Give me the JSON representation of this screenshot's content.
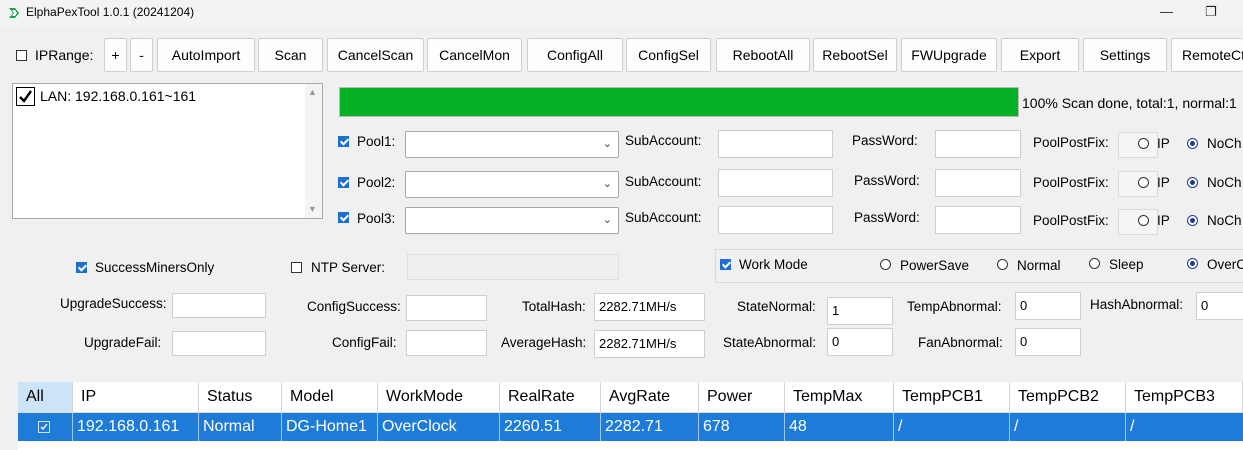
{
  "window": {
    "title": "ElphaPexTool 1.0.1 (20241204)",
    "minimize_glyph": "—",
    "maximize_glyph": "❐"
  },
  "toolbar": {
    "iprange_label": "IPRange:",
    "iprange_checked": false,
    "buttons": [
      "+",
      "-",
      "AutoImport",
      "Scan",
      "CancelScan",
      "CancelMon",
      "ConfigAll",
      "ConfigSel",
      "RebootAll",
      "RebootSel",
      "FWUpgrade",
      "Export",
      "Settings",
      "RemoteCt"
    ]
  },
  "ip_list": {
    "items": [
      {
        "label": "LAN: 192.168.0.161~161",
        "checked": true
      }
    ],
    "scroll_up_glyph": "▲",
    "scroll_down_glyph": "▼"
  },
  "progress": {
    "fraction": 1.0,
    "color": "#06b025",
    "status_text": "100% Scan done, total:1, normal:1"
  },
  "pools": [
    {
      "label": "Pool1:",
      "checked": true,
      "url": "",
      "subaccount_label": "SubAccount:",
      "subaccount": "",
      "password_label": "PassWord:",
      "password": "",
      "postfix_label": "PoolPostFix:",
      "opt_ip": "IP",
      "opt_nochange": "NoCh",
      "selected": "NoCh"
    },
    {
      "label": "Pool2:",
      "checked": true,
      "url": "",
      "subaccount_label": "SubAccount:",
      "subaccount": "",
      "password_label": "PassWord:",
      "password": "",
      "postfix_label": "PoolPostFix:",
      "opt_ip": "IP",
      "opt_nochange": "NoCh",
      "selected": "NoCh"
    },
    {
      "label": "Pool3:",
      "checked": true,
      "url": "",
      "subaccount_label": "SubAccount:",
      "subaccount": "",
      "password_label": "PassWord:",
      "password": "",
      "postfix_label": "PoolPostFix:",
      "opt_ip": "IP",
      "opt_nochange": "NoCh",
      "selected": "NoCh"
    }
  ],
  "options": {
    "success_only_label": "SuccessMinersOnly",
    "success_only_checked": true,
    "ntp_label": "NTP Server:",
    "ntp_checked": false,
    "ntp_value": ""
  },
  "workmode": {
    "label": "Work Mode",
    "checked": true,
    "options": [
      "PowerSave",
      "Normal",
      "Sleep",
      "OverC"
    ],
    "selected": "OverC"
  },
  "stats": {
    "upgrade_success_label": "UpgradeSuccess:",
    "upgrade_success": "",
    "upgrade_fail_label": "UpgradeFail:",
    "upgrade_fail": "",
    "config_success_label": "ConfigSuccess:",
    "config_success": "",
    "config_fail_label": "ConfigFail:",
    "config_fail": "",
    "total_hash_label": "TotalHash:",
    "total_hash": "2282.71MH/s",
    "average_hash_label": "AverageHash:",
    "average_hash": "2282.71MH/s",
    "state_normal_label": "StateNormal:",
    "state_normal": "1",
    "state_abnormal_label": "StateAbnormal:",
    "state_abnormal": "0",
    "temp_abnormal_label": "TempAbnormal:",
    "temp_abnormal": "0",
    "fan_abnormal_label": "FanAbnormal:",
    "fan_abnormal": "0",
    "hash_abnormal_label": "HashAbnormal:",
    "hash_abnormal": "0"
  },
  "table": {
    "columns": [
      "All",
      "IP",
      "Status",
      "Model",
      "WorkMode",
      "RealRate",
      "AvgRate",
      "Power",
      "TempMax",
      "TempPCB1",
      "TempPCB2",
      "TempPCB3"
    ],
    "rows": [
      {
        "checked": true,
        "cells": [
          "192.168.0.161",
          "Normal",
          "DG-Home1",
          "OverClock",
          "2260.51",
          "2282.71",
          "678",
          "48",
          "/",
          "/",
          "/"
        ]
      }
    ],
    "selected_row_color": "#1f7bd8"
  }
}
